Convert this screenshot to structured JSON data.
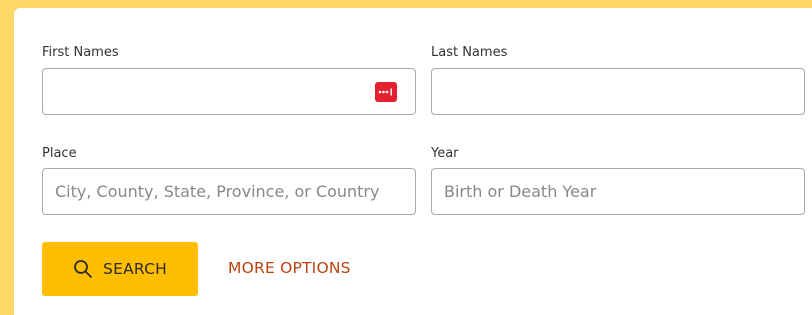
{
  "form": {
    "first_names": {
      "label": "First Names",
      "value": "",
      "placeholder": "",
      "password_manager_icon": "password-manager-icon"
    },
    "last_names": {
      "label": "Last Names",
      "value": "",
      "placeholder": ""
    },
    "place": {
      "label": "Place",
      "value": "",
      "placeholder": "City, County, State, Province, or Country"
    },
    "year": {
      "label": "Year",
      "value": "",
      "placeholder": "Birth or Death Year"
    }
  },
  "actions": {
    "search_label": "SEARCH",
    "search_icon": "search-icon",
    "more_options_label": "MORE OPTIONS"
  },
  "colors": {
    "page_background": "#ffd866",
    "search_button": "#ffbf00",
    "more_options_link": "#b9430f",
    "password_icon": "#e4202e"
  }
}
